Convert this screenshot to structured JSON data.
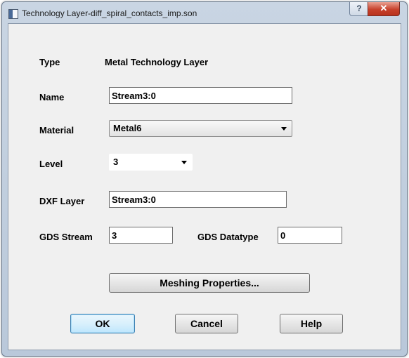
{
  "window": {
    "title": "Technology Layer-diff_spiral_contacts_imp.son",
    "help_glyph": "?",
    "close_glyph": "✕"
  },
  "form": {
    "type_label": "Type",
    "type_value": "Metal Technology Layer",
    "name_label": "Name",
    "name_value": "Stream3:0",
    "material_label": "Material",
    "material_value": "Metal6",
    "level_label": "Level",
    "level_value": "3",
    "dxf_label": "DXF Layer",
    "dxf_value": "Stream3:0",
    "gds_stream_label": "GDS Stream",
    "gds_stream_value": "3",
    "gds_datatype_label": "GDS Datatype",
    "gds_datatype_value": "0"
  },
  "buttons": {
    "meshing": "Meshing Properties...",
    "ok": "OK",
    "cancel": "Cancel",
    "help": "Help"
  }
}
